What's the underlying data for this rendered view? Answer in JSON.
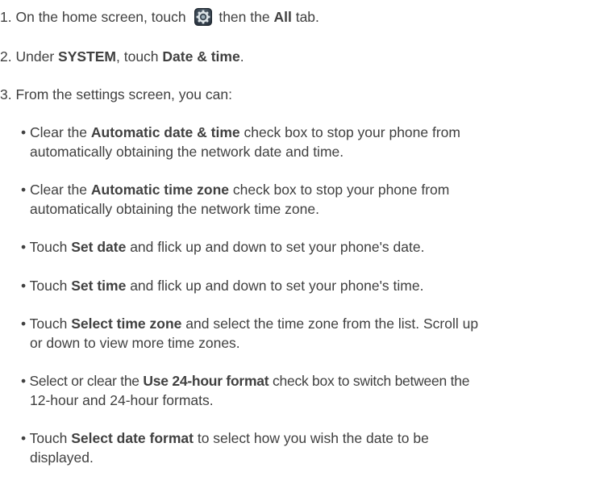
{
  "steps": {
    "s1": {
      "num": "1.",
      "pre": "On the home screen, touch",
      "icon": "settings-gear-icon",
      "mid": "then the",
      "bold": "All",
      "post": "tab."
    },
    "s2": {
      "num": "2.",
      "pre": "Under",
      "bold1": "SYSTEM",
      "mid": ", touch",
      "bold2": "Date & time",
      "post": "."
    },
    "s3": {
      "num": "3.",
      "text": "From the settings screen, you can:"
    }
  },
  "bullets": {
    "b1": {
      "pre": "• Clear the",
      "bold": "Automatic date & time",
      "post": "check box to stop your phone from",
      "cont": "automatically obtaining the network date and time."
    },
    "b2": {
      "pre": "• Clear the",
      "bold": "Automatic time zone",
      "post": "check box to stop your phone from",
      "cont": "automatically obtaining the network time zone."
    },
    "b3": {
      "pre": "• Touch",
      "bold": "Set date",
      "post": "and flick up and down to set your phone's date."
    },
    "b4": {
      "pre": "• Touch",
      "bold": "Set time",
      "post": "and flick up and down to set your phone's time."
    },
    "b5": {
      "pre": "• Touch",
      "bold": "Select time zone",
      "post": "and select the time zone from the list. Scroll up",
      "cont": "or down to view more time zones."
    },
    "b6": {
      "pre": "• Select or clear the",
      "bold": "Use 24-hour format",
      "post": "check box to switch between the",
      "cont": "12-hour and 24-hour formats."
    },
    "b7": {
      "pre": "• Touch",
      "bold": "Select date format",
      "post": "to select how you wish the date to be",
      "cont": "displayed."
    }
  }
}
